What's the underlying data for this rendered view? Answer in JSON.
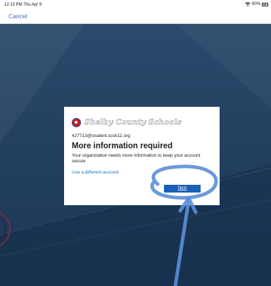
{
  "status_bar": {
    "time": "12:13 PM  Thu Apr 9",
    "battery": "60%",
    "icons": [
      "wifi-icon",
      "battery-icon"
    ]
  },
  "nav": {
    "cancel_label": "Cancel"
  },
  "dialog": {
    "brand_name": "Shelby County Schools",
    "brand_icon": "school-logo-icon",
    "account_email": "427713@student.scsk12.org",
    "title": "More information required",
    "message": "Your organization needs more information to keep your account secure",
    "different_account_label": "Use a different account",
    "next_label": "Next"
  },
  "annotation": {
    "color": "#5b8fd6",
    "shapes": [
      "circle-annotation",
      "arrow-annotation"
    ]
  }
}
